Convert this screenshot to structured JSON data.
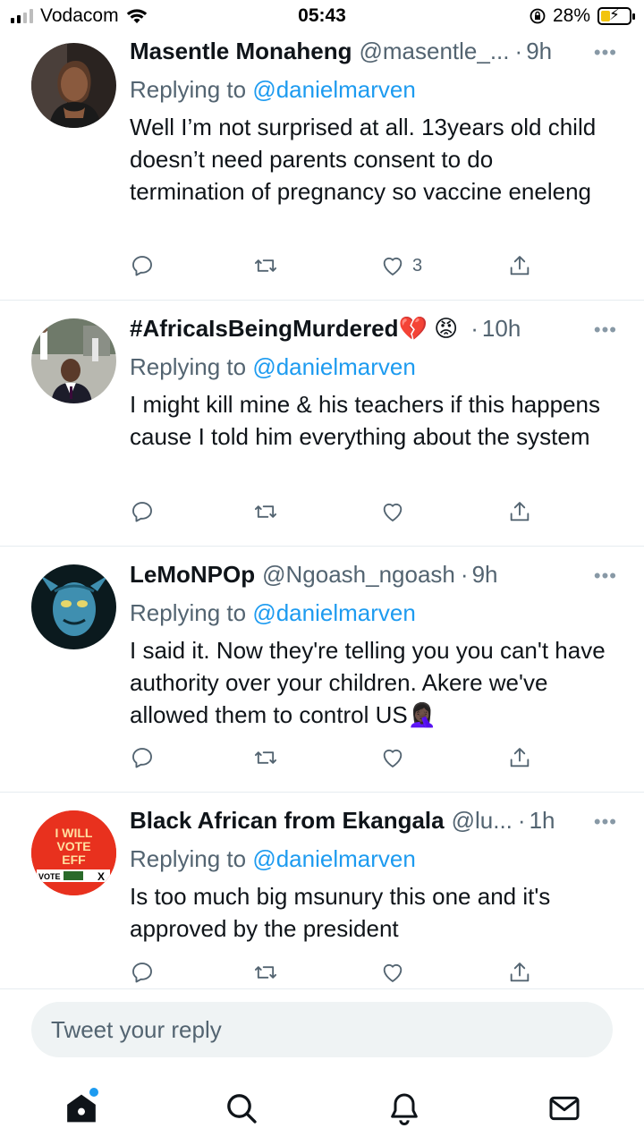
{
  "status_bar": {
    "carrier": "Vodacom",
    "time": "05:43",
    "battery_percent": "28%"
  },
  "tweets": [
    {
      "name": "Masentle Monaheng",
      "handle": "@masentle_...",
      "time": "9h",
      "replying_prefix": "Replying to",
      "replying_to": "@danielmarven",
      "text": "Well I’m not surprised at all. 13years old child doesn’t need parents consent to do termination of pregnancy so vaccine eneleng",
      "likes": "3"
    },
    {
      "name": "#AfricaIsBeingMurdered💔 😡",
      "handle": "",
      "time": "10h",
      "replying_prefix": "Replying to",
      "replying_to": "@danielmarven",
      "text": "I might kill mine & his teachers if this happens cause I told him everything about the system",
      "likes": ""
    },
    {
      "name": "LeMoNPOp",
      "handle": "@Ngoash_ngoash",
      "time": "9h",
      "replying_prefix": "Replying to",
      "replying_to": "@danielmarven",
      "text": "I said it. Now they're telling you you can't have authority over your children. Akere we've allowed them to control US🤦🏿‍♀️",
      "likes": ""
    },
    {
      "name": "Black African from Ekangala",
      "handle": "@lu...",
      "time": "1h",
      "replying_prefix": "Replying to",
      "replying_to": "@danielmarven",
      "text": "Is too much big msunury this one and it's approved by the president",
      "likes": ""
    }
  ],
  "avatar4": {
    "line1": "I WILL",
    "line2": "VOTE",
    "line3": "EFF",
    "strip": "VOTE",
    "mark": "X"
  },
  "reply_box": {
    "placeholder": "Tweet your reply"
  },
  "colors": {
    "accent": "#1d9bf0",
    "secondary_text": "#536471",
    "divider": "#e6ecf0"
  }
}
